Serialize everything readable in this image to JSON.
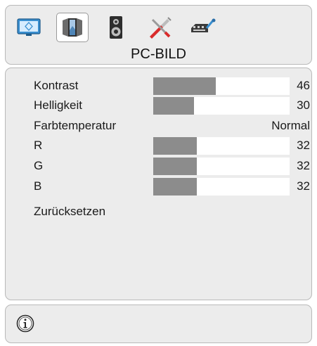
{
  "header": {
    "title": "PC-BILD",
    "tabs": [
      {
        "icon": "monitor-icon",
        "active": false
      },
      {
        "icon": "picture-icon",
        "active": true
      },
      {
        "icon": "speaker-icon",
        "active": false
      },
      {
        "icon": "tools-icon",
        "active": false
      },
      {
        "icon": "source-icon",
        "active": false
      }
    ]
  },
  "settings": [
    {
      "label": "Kontrast",
      "value": "46",
      "level": 0.46,
      "has_bar": true
    },
    {
      "label": "Helligkeit",
      "value": "30",
      "level": 0.3,
      "has_bar": true
    },
    {
      "label": "Farbtemperatur",
      "value": "Normal",
      "has_bar": false
    },
    {
      "label": "R",
      "value": "32",
      "level": 0.32,
      "has_bar": true
    },
    {
      "label": "G",
      "value": "32",
      "level": 0.32,
      "has_bar": true
    },
    {
      "label": "B",
      "value": "32",
      "level": 0.32,
      "has_bar": true
    },
    {
      "label": "Zurücksetzen",
      "value": "",
      "has_bar": false
    }
  ],
  "info": {
    "icon": "info-icon"
  },
  "colors": {
    "panel_bg": "#ececec",
    "bar_fill": "#8c8c8c",
    "bar_track": "#ffffff"
  }
}
